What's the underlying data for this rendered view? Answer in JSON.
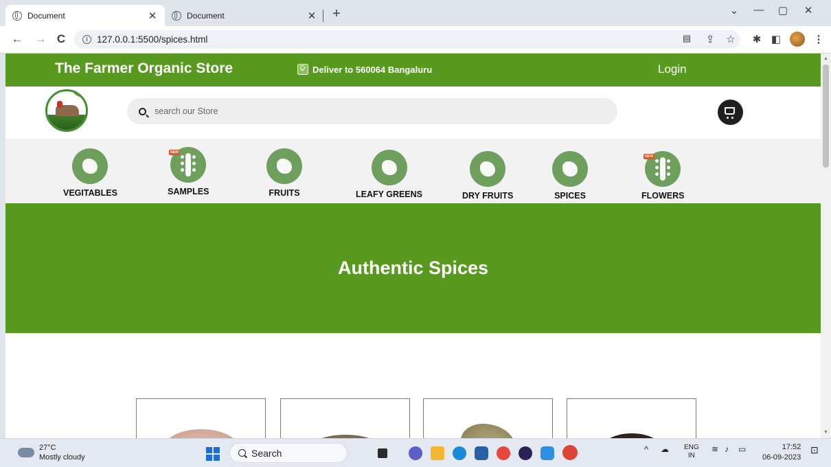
{
  "browser": {
    "tabs": [
      {
        "title": "Document",
        "active": true
      },
      {
        "title": "Document",
        "active": false
      }
    ],
    "url": "127.0.0.1:5500/spices.html",
    "window_controls": {
      "minimize": "—",
      "maximize": "▢",
      "close": "✕",
      "collapse": "⌄"
    }
  },
  "site": {
    "store_name": "The Farmer Organic Store",
    "deliver_text": "Deliver to 560064 Bangaluru",
    "login_label": "Login",
    "search_placeholder": "search our Store",
    "categories": [
      {
        "label": "VEGITABLES",
        "icon": "vegetables-icon",
        "is_new": false
      },
      {
        "label": "SAMPLES",
        "icon": "wheat-icon",
        "is_new": true
      },
      {
        "label": "FRUITS",
        "icon": "fruits-basket-icon",
        "is_new": false
      },
      {
        "label": "LEAFY GREENS",
        "icon": "leafy-greens-icon",
        "is_new": false
      },
      {
        "label": "DRY FRUITS",
        "icon": "nuts-icon",
        "is_new": false
      },
      {
        "label": "SPICES",
        "icon": "ginger-icon",
        "is_new": false
      },
      {
        "label": "FLOWERS",
        "icon": "wheat-icon",
        "is_new": true
      }
    ],
    "new_badge": "NEW",
    "hero_title": "Authentic Spices",
    "products": [
      {
        "name": "salt-powder-pile",
        "color": "#d9b3a3"
      },
      {
        "name": "cumin-seeds-pile",
        "color": "#8a7a5a"
      },
      {
        "name": "bay-leaves-pile",
        "color": "#a49a6c"
      },
      {
        "name": "black-pepper-pile",
        "color": "#3a2e26"
      }
    ],
    "colors": {
      "brand_green": "#58991f",
      "category_green": "#6e9f5c",
      "category_bar_bg": "#f2f2f2"
    }
  },
  "taskbar": {
    "temperature": "27°C",
    "weather": "Mostly cloudy",
    "search_label": "Search",
    "lang_top": "ENG",
    "lang_bottom": "IN",
    "time": "17:52",
    "date": "06-09-2023"
  }
}
